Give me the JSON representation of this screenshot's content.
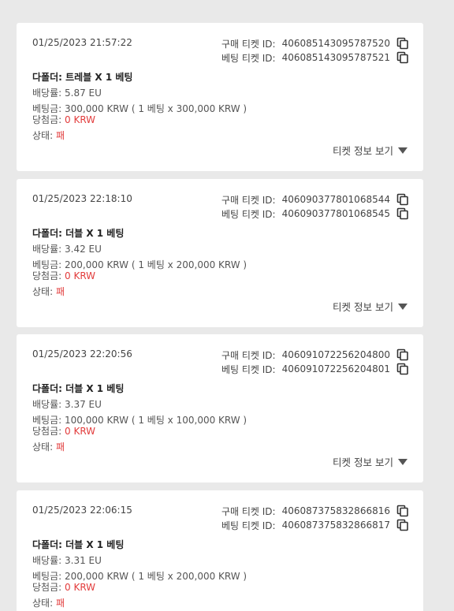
{
  "labels": {
    "purchase_ticket_id": "구매 티켓 ID:",
    "bet_ticket_id": "베팅 티켓 ID:",
    "odds": "배당률:",
    "stake": "베팅금:",
    "winnings": "당첨금:",
    "status": "상태:",
    "view_ticket_info": "티켓 정보 보기"
  },
  "colors": {
    "background": "#e9e9e9",
    "card": "#ffffff",
    "loss_red": "#e23b3b"
  },
  "tickets": [
    {
      "datetime": "01/25/2023 21:57:22",
      "purchase_id": "406085143095787520",
      "bet_id": "406085143095787521",
      "bet_type": "다폴더: 트레블 X 1 베팅",
      "odds": "5.87 EU",
      "stake": "300,000 KRW ( 1 베팅 x 300,000 KRW )",
      "winnings": "0 KRW",
      "status": "패"
    },
    {
      "datetime": "01/25/2023 22:18:10",
      "purchase_id": "406090377801068544",
      "bet_id": "406090377801068545",
      "bet_type": "다폴더: 더블 X 1 베팅",
      "odds": "3.42 EU",
      "stake": "200,000 KRW ( 1 베팅 x 200,000 KRW )",
      "winnings": "0 KRW",
      "status": "패"
    },
    {
      "datetime": "01/25/2023 22:20:56",
      "purchase_id": "406091072256204800",
      "bet_id": "406091072256204801",
      "bet_type": "다폴더: 더블 X 1 베팅",
      "odds": "3.37 EU",
      "stake": "100,000 KRW ( 1 베팅 x 100,000 KRW )",
      "winnings": "0 KRW",
      "status": "패"
    },
    {
      "datetime": "01/25/2023 22:06:15",
      "purchase_id": "406087375832866816",
      "bet_id": "406087375832866817",
      "bet_type": "다폴더: 더블 X 1 베팅",
      "odds": "3.31 EU",
      "stake": "200,000 KRW ( 1 베팅 x 200,000 KRW )",
      "winnings": "0 KRW",
      "status": "패"
    }
  ]
}
